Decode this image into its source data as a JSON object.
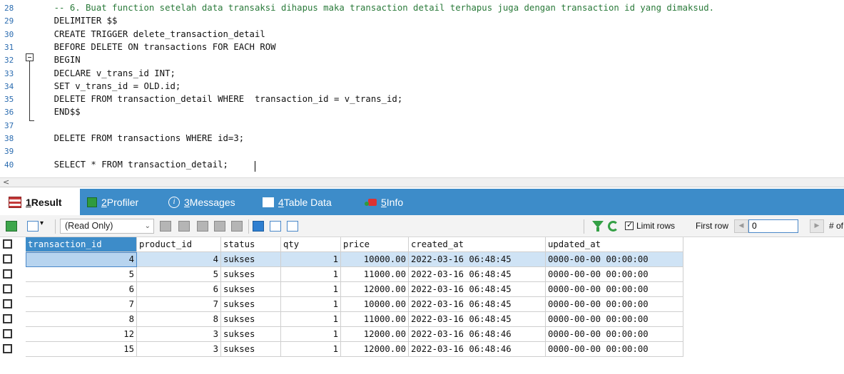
{
  "editor": {
    "lines": [
      {
        "num": "28",
        "text": "    -- 6. Buat function setelah data transaksi dihapus maka transaction detail terhapus juga dengan transaction id yang dimaksud.",
        "kind": "comment"
      },
      {
        "num": "29",
        "text": "    DELIMITER $$",
        "kind": "code"
      },
      {
        "num": "30",
        "text": "    CREATE TRIGGER delete_transaction_detail",
        "kind": "code"
      },
      {
        "num": "31",
        "text": "    BEFORE DELETE ON transactions FOR EACH ROW",
        "kind": "code"
      },
      {
        "num": "32",
        "text": "    BEGIN",
        "kind": "code"
      },
      {
        "num": "33",
        "text": "    DECLARE v_trans_id INT;",
        "kind": "code"
      },
      {
        "num": "34",
        "text": "    SET v_trans_id = OLD.id;",
        "kind": "code"
      },
      {
        "num": "35",
        "text": "    DELETE FROM transaction_detail WHERE  transaction_id = v_trans_id;",
        "kind": "code"
      },
      {
        "num": "36",
        "text": "    END$$",
        "kind": "code"
      },
      {
        "num": "37",
        "text": "",
        "kind": "code"
      },
      {
        "num": "38",
        "text": "    DELETE FROM transactions WHERE id=3;",
        "kind": "code"
      },
      {
        "num": "39",
        "text": "",
        "kind": "code"
      },
      {
        "num": "40",
        "text": "    SELECT * FROM transaction_detail;",
        "kind": "code"
      }
    ],
    "scroll_left_arrow": "<"
  },
  "tabs": {
    "result": {
      "num": "1",
      "label": " Result"
    },
    "profiler": {
      "num": "2",
      "label": " Profiler"
    },
    "messages": {
      "num": "3",
      "label": " Messages",
      "icon_glyph": "i"
    },
    "table_data": {
      "num": "4",
      "label": " Table Data"
    },
    "info": {
      "num": "5",
      "label": " Info"
    }
  },
  "toolbar": {
    "mode": "(Read Only)",
    "limit_rows_label": "Limit rows",
    "limit_rows_checked": true,
    "first_row_label": "First row",
    "first_row_value": "0",
    "num_rows_label": "# of r",
    "prev_glyph": "◀",
    "next_glyph": "▶",
    "chevron": "⌄"
  },
  "grid": {
    "columns": [
      "transaction_id",
      "product_id",
      "status",
      "qty",
      "price",
      "created_at",
      "updated_at"
    ],
    "rows": [
      [
        "4",
        "4",
        "sukses",
        "1",
        "10000.00",
        "2022-03-16 06:48:45",
        "0000-00-00 00:00:00"
      ],
      [
        "5",
        "5",
        "sukses",
        "1",
        "11000.00",
        "2022-03-16 06:48:45",
        "0000-00-00 00:00:00"
      ],
      [
        "6",
        "6",
        "sukses",
        "1",
        "12000.00",
        "2022-03-16 06:48:45",
        "0000-00-00 00:00:00"
      ],
      [
        "7",
        "7",
        "sukses",
        "1",
        "10000.00",
        "2022-03-16 06:48:45",
        "0000-00-00 00:00:00"
      ],
      [
        "8",
        "8",
        "sukses",
        "1",
        "11000.00",
        "2022-03-16 06:48:45",
        "0000-00-00 00:00:00"
      ],
      [
        "12",
        "3",
        "sukses",
        "1",
        "12000.00",
        "2022-03-16 06:48:46",
        "0000-00-00 00:00:00"
      ],
      [
        "15",
        "3",
        "sukses",
        "1",
        "12000.00",
        "2022-03-16 06:48:46",
        "0000-00-00 00:00:00"
      ]
    ],
    "selected_row": 0
  },
  "colors": {
    "accent": "#3d8cc9",
    "selection": "#cfe3f5",
    "comment": "#2a7a3a",
    "line_number": "#2b6cb0"
  },
  "icons": [
    "result-icon",
    "profiler-icon",
    "messages-icon",
    "table-data-icon",
    "info-icon",
    "filter-icon",
    "refresh-icon"
  ]
}
